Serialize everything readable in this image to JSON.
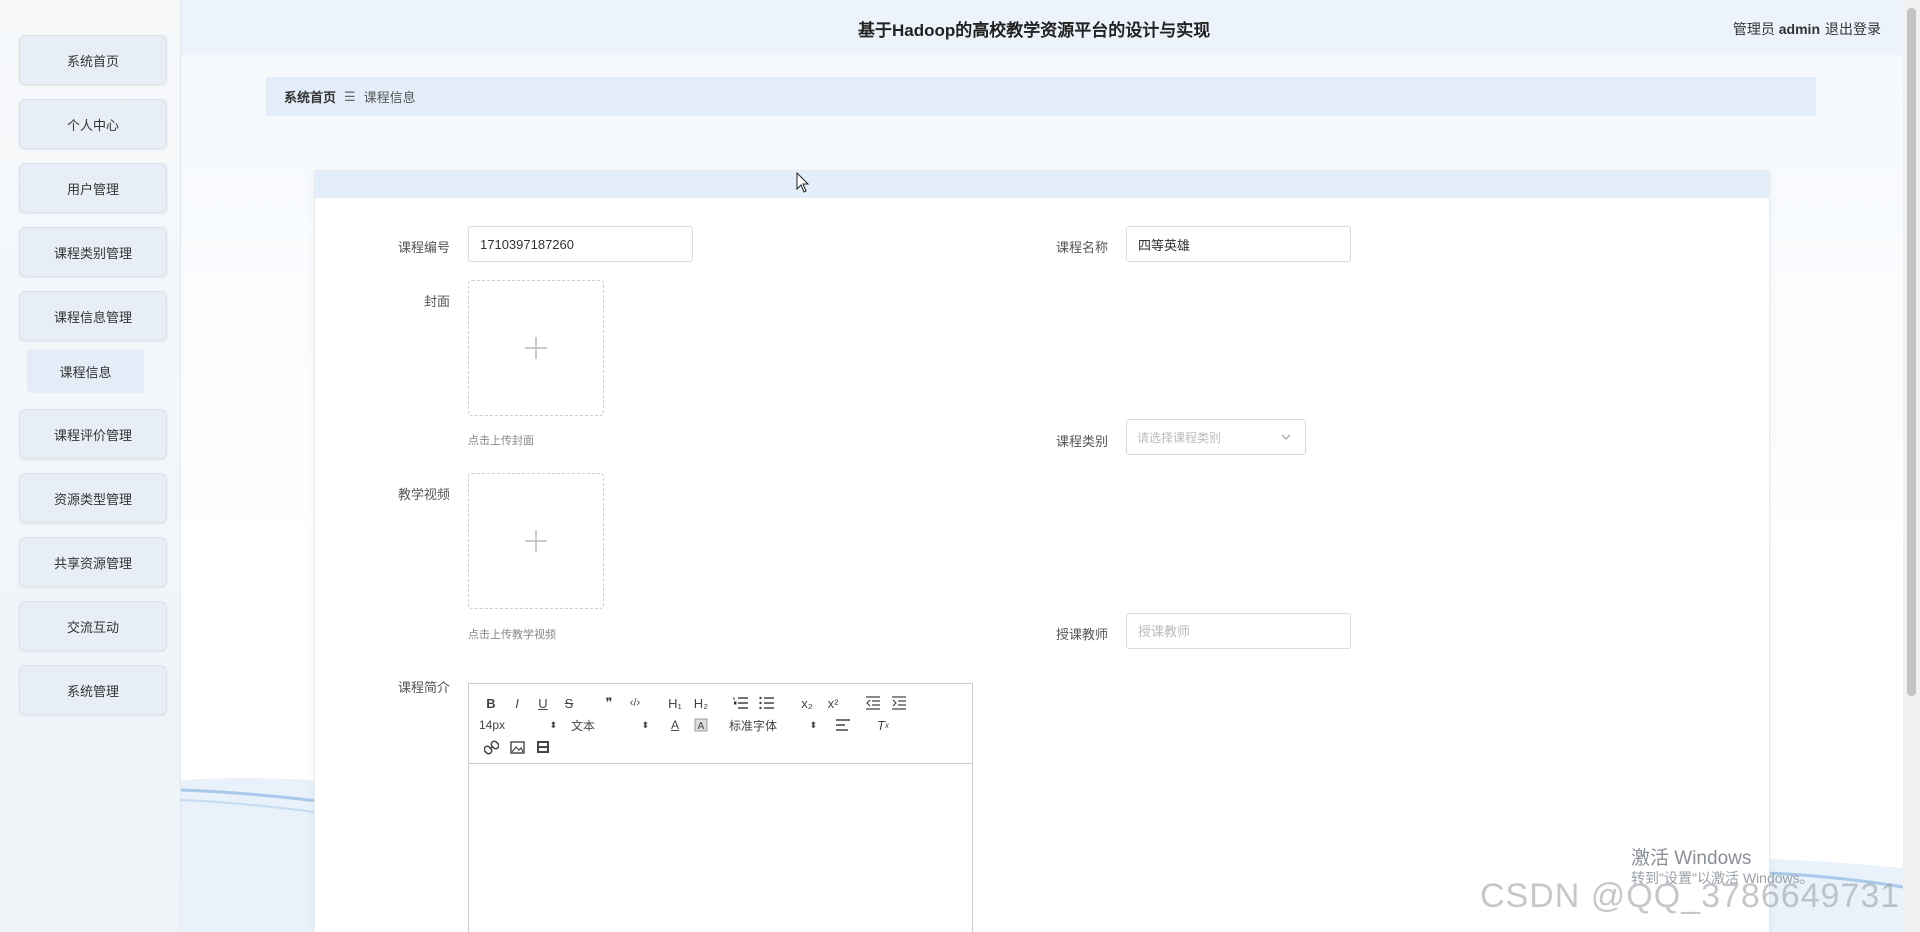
{
  "app": {
    "title": "基于Hadoop的高校教学资源平台的设计与实现",
    "user_role": "管理员",
    "user_name": "admin",
    "logout": "退出登录"
  },
  "sidebar": {
    "items": [
      {
        "label": "系统首页"
      },
      {
        "label": "个人中心"
      },
      {
        "label": "用户管理"
      },
      {
        "label": "课程类别管理"
      },
      {
        "label": "课程信息管理"
      },
      {
        "label": "课程评价管理"
      },
      {
        "label": "资源类型管理"
      },
      {
        "label": "共享资源管理"
      },
      {
        "label": "交流互动"
      },
      {
        "label": "系统管理"
      }
    ],
    "subitem": {
      "label": "课程信息"
    }
  },
  "breadcrumb": {
    "home": "系统首页",
    "separator": "☰",
    "current": "课程信息"
  },
  "form": {
    "course_no": {
      "label": "课程编号",
      "value": "1710397187260"
    },
    "course_name": {
      "label": "课程名称",
      "value": "四等英雄"
    },
    "cover": {
      "label": "封面",
      "hint": "点击上传封面"
    },
    "course_type": {
      "label": "课程类别",
      "placeholder": "请选择课程类别"
    },
    "video": {
      "label": "教学视频",
      "hint": "点击上传教学视频"
    },
    "teacher": {
      "label": "授课教师",
      "placeholder": "授课教师"
    },
    "intro": {
      "label": "课程简介"
    }
  },
  "editor": {
    "font_size": "14px",
    "text_type": "文本",
    "font_family": "标准字体",
    "buttons": {
      "bold": "B",
      "italic": "I",
      "underline": "U",
      "strike": "S",
      "quote": "❞",
      "code": "‹/›",
      "h1": "H₁",
      "h2": "H₂",
      "sub": "x₂",
      "sup": "x²"
    }
  },
  "watermark": {
    "activate": "激活 Windows",
    "activate_sub": "转到\"设置\"以激活 Windows。",
    "csdn": "CSDN @QQ_3786649731"
  },
  "colors": {
    "accent": "#e4eefa",
    "sidebar_item": "#e8eef5"
  }
}
